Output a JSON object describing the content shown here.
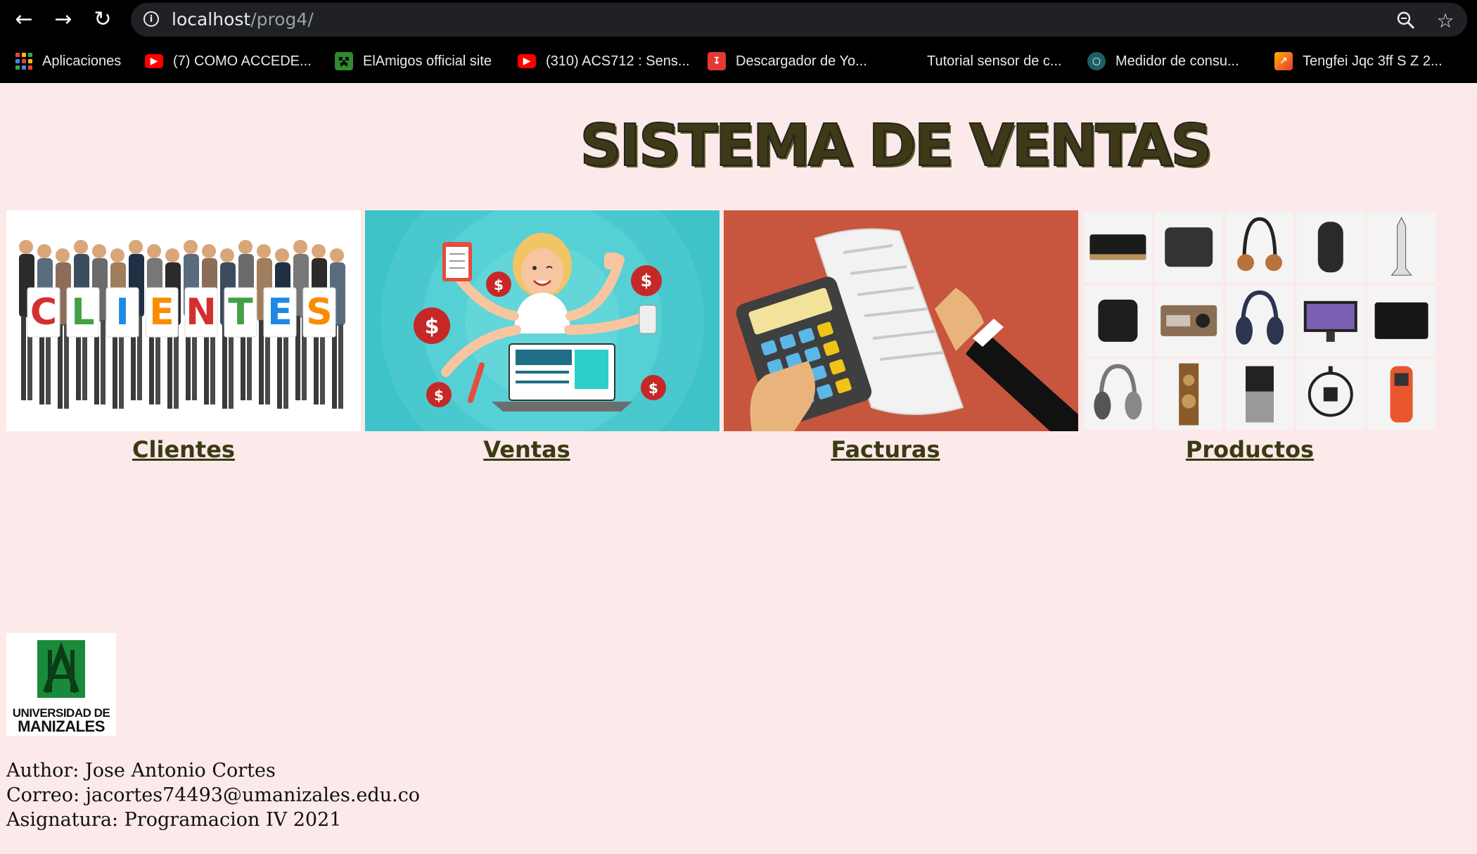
{
  "browser": {
    "url_host": "localhost",
    "url_path": "/prog4/",
    "bookmarks": [
      {
        "label": "Aplicaciones",
        "icon": "apps-grid-icon"
      },
      {
        "label": "(7) COMO ACCEDE...",
        "icon": "youtube-icon"
      },
      {
        "label": "ElAmigos official site",
        "icon": "creeper-icon"
      },
      {
        "label": "(310) ACS712 : Sens...",
        "icon": "youtube-icon"
      },
      {
        "label": "Descargador de Yo...",
        "icon": "download-icon"
      },
      {
        "label": "Tutorial sensor de c...",
        "icon": ""
      },
      {
        "label": "Medidor de consu...",
        "icon": "globe-icon"
      },
      {
        "label": "Tengfei Jqc 3ff S Z 2...",
        "icon": "aliexpress-icon"
      }
    ]
  },
  "page": {
    "title": "SISTEMA DE VENTAS",
    "cards": [
      {
        "label": "Clientes",
        "image_letters": [
          "C",
          "L",
          "I",
          "E",
          "N",
          "T",
          "E",
          "S"
        ]
      },
      {
        "label": "Ventas"
      },
      {
        "label": "Facturas"
      },
      {
        "label": "Productos"
      }
    ],
    "logo": {
      "line1": "UNIVERSIDAD DE",
      "line2": "MANIZALES"
    },
    "footer": {
      "author": "Author: Jose Antonio Cortes",
      "email": "Correo: jacortes74493@umanizales.edu.co",
      "course": "Asignatura: Programacion IV 2021"
    }
  }
}
